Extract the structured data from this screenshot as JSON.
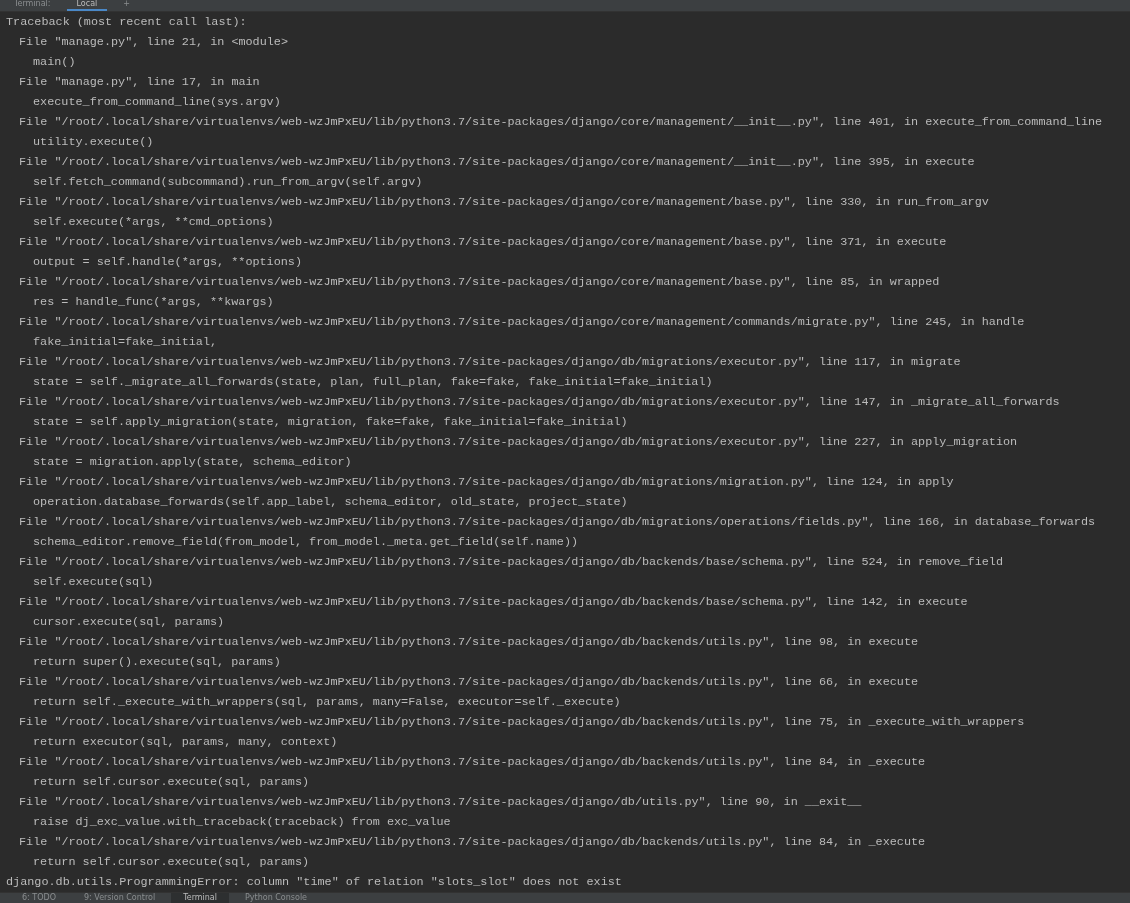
{
  "tabs": [
    {
      "label": "Terminal:",
      "selected": false
    },
    {
      "label": "Local",
      "selected": true
    },
    {
      "label": "+",
      "selected": false
    }
  ],
  "terminal": {
    "header": "Traceback (most recent call last):",
    "frames": [
      {
        "file": "File \"manage.py\", line 21, in <module>",
        "code": "main()"
      },
      {
        "file": "File \"manage.py\", line 17, in main",
        "code": "execute_from_command_line(sys.argv)"
      },
      {
        "file": "File \"/root/.local/share/virtualenvs/web-wzJmPxEU/lib/python3.7/site-packages/django/core/management/__init__.py\", line 401, in execute_from_command_line",
        "code": "utility.execute()"
      },
      {
        "file": "File \"/root/.local/share/virtualenvs/web-wzJmPxEU/lib/python3.7/site-packages/django/core/management/__init__.py\", line 395, in execute",
        "code": "self.fetch_command(subcommand).run_from_argv(self.argv)"
      },
      {
        "file": "File \"/root/.local/share/virtualenvs/web-wzJmPxEU/lib/python3.7/site-packages/django/core/management/base.py\", line 330, in run_from_argv",
        "code": "self.execute(*args, **cmd_options)"
      },
      {
        "file": "File \"/root/.local/share/virtualenvs/web-wzJmPxEU/lib/python3.7/site-packages/django/core/management/base.py\", line 371, in execute",
        "code": "output = self.handle(*args, **options)"
      },
      {
        "file": "File \"/root/.local/share/virtualenvs/web-wzJmPxEU/lib/python3.7/site-packages/django/core/management/base.py\", line 85, in wrapped",
        "code": "res = handle_func(*args, **kwargs)"
      },
      {
        "file": "File \"/root/.local/share/virtualenvs/web-wzJmPxEU/lib/python3.7/site-packages/django/core/management/commands/migrate.py\", line 245, in handle",
        "code": "fake_initial=fake_initial,"
      },
      {
        "file": "File \"/root/.local/share/virtualenvs/web-wzJmPxEU/lib/python3.7/site-packages/django/db/migrations/executor.py\", line 117, in migrate",
        "code": "state = self._migrate_all_forwards(state, plan, full_plan, fake=fake, fake_initial=fake_initial)"
      },
      {
        "file": "File \"/root/.local/share/virtualenvs/web-wzJmPxEU/lib/python3.7/site-packages/django/db/migrations/executor.py\", line 147, in _migrate_all_forwards",
        "code": "state = self.apply_migration(state, migration, fake=fake, fake_initial=fake_initial)"
      },
      {
        "file": "File \"/root/.local/share/virtualenvs/web-wzJmPxEU/lib/python3.7/site-packages/django/db/migrations/executor.py\", line 227, in apply_migration",
        "code": "state = migration.apply(state, schema_editor)"
      },
      {
        "file": "File \"/root/.local/share/virtualenvs/web-wzJmPxEU/lib/python3.7/site-packages/django/db/migrations/migration.py\", line 124, in apply",
        "code": "operation.database_forwards(self.app_label, schema_editor, old_state, project_state)"
      },
      {
        "file": "File \"/root/.local/share/virtualenvs/web-wzJmPxEU/lib/python3.7/site-packages/django/db/migrations/operations/fields.py\", line 166, in database_forwards",
        "code": "schema_editor.remove_field(from_model, from_model._meta.get_field(self.name))"
      },
      {
        "file": "File \"/root/.local/share/virtualenvs/web-wzJmPxEU/lib/python3.7/site-packages/django/db/backends/base/schema.py\", line 524, in remove_field",
        "code": "self.execute(sql)"
      },
      {
        "file": "File \"/root/.local/share/virtualenvs/web-wzJmPxEU/lib/python3.7/site-packages/django/db/backends/base/schema.py\", line 142, in execute",
        "code": "cursor.execute(sql, params)"
      },
      {
        "file": "File \"/root/.local/share/virtualenvs/web-wzJmPxEU/lib/python3.7/site-packages/django/db/backends/utils.py\", line 98, in execute",
        "code": "return super().execute(sql, params)"
      },
      {
        "file": "File \"/root/.local/share/virtualenvs/web-wzJmPxEU/lib/python3.7/site-packages/django/db/backends/utils.py\", line 66, in execute",
        "code": "return self._execute_with_wrappers(sql, params, many=False, executor=self._execute)"
      },
      {
        "file": "File \"/root/.local/share/virtualenvs/web-wzJmPxEU/lib/python3.7/site-packages/django/db/backends/utils.py\", line 75, in _execute_with_wrappers",
        "code": "return executor(sql, params, many, context)"
      },
      {
        "file": "File \"/root/.local/share/virtualenvs/web-wzJmPxEU/lib/python3.7/site-packages/django/db/backends/utils.py\", line 84, in _execute",
        "code": "return self.cursor.execute(sql, params)"
      },
      {
        "file": "File \"/root/.local/share/virtualenvs/web-wzJmPxEU/lib/python3.7/site-packages/django/db/utils.py\", line 90, in __exit__",
        "code": "raise dj_exc_value.with_traceback(traceback) from exc_value"
      },
      {
        "file": "File \"/root/.local/share/virtualenvs/web-wzJmPxEU/lib/python3.7/site-packages/django/db/backends/utils.py\", line 84, in _execute",
        "code": "return self.cursor.execute(sql, params)"
      }
    ],
    "error": "django.db.utils.ProgrammingError: column \"time\" of relation \"slots_slot\" does not exist"
  },
  "tool_tabs": [
    {
      "label": "6: TODO",
      "selected": false
    },
    {
      "label": "9: Version Control",
      "selected": false
    },
    {
      "label": "Terminal",
      "selected": true
    },
    {
      "label": "Python Console",
      "selected": false
    }
  ]
}
